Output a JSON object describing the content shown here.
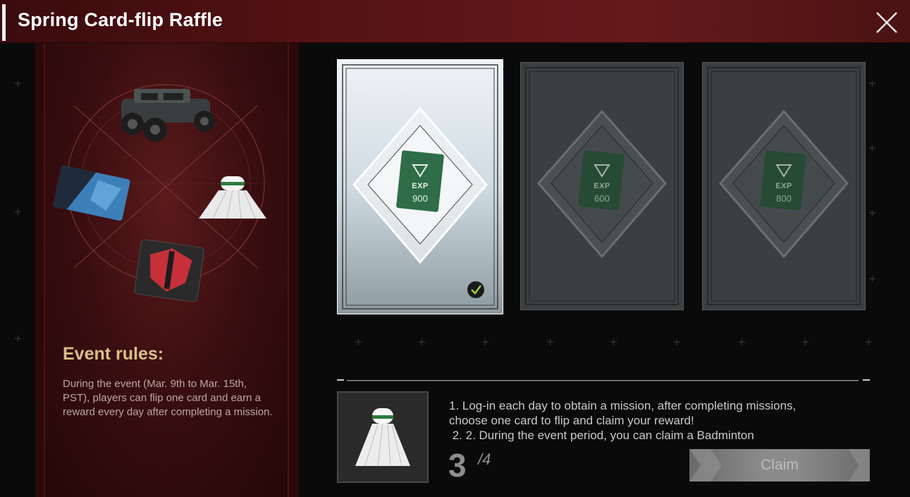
{
  "header": {
    "title": "Spring Card-flip Raffle"
  },
  "rules": {
    "title": "Event rules:",
    "text": "During the event (Mar. 9th to Mar. 15th, PST), players can flip one card and earn a reward every day after completing a mission."
  },
  "rewards_wheel": {
    "items": [
      "vehicle-icon",
      "card-skin-icon",
      "badminton-icon",
      "emblem-icon"
    ]
  },
  "cards": [
    {
      "label": "EXP",
      "value": "900",
      "state": "claimed"
    },
    {
      "label": "EXP",
      "value": "600",
      "state": "available"
    },
    {
      "label": "EXP",
      "value": "800",
      "state": "available"
    }
  ],
  "mission": {
    "line1": "1. Log-in each day to obtain a mission, after completing missions,",
    "line2": "choose one card to flip and claim your reward!",
    "line3": " 2. 2. During the event period, you can claim a Badminton",
    "progress_current": "3",
    "progress_total": "/4",
    "claim_label": "Claim"
  },
  "colors": {
    "header": "#5a1416",
    "rules_title": "#d9c089",
    "card_check": "#9fd040"
  }
}
